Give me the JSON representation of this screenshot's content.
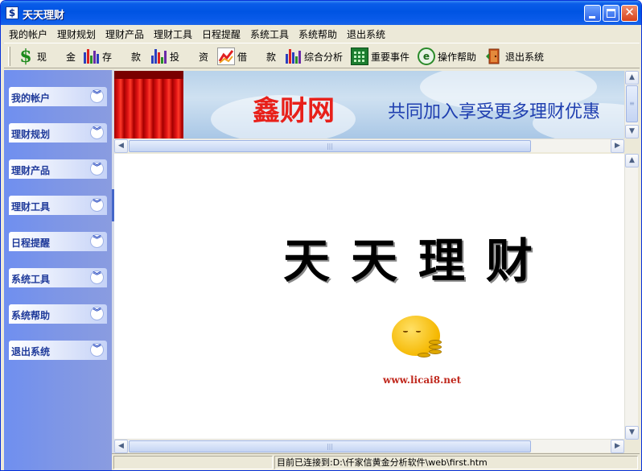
{
  "window": {
    "title": "天天理财",
    "app_icon_glyph": "$",
    "close_glyph": "✕"
  },
  "menu": [
    {
      "label": "我的帐户"
    },
    {
      "label": "理财规划"
    },
    {
      "label": "理财产品"
    },
    {
      "label": "理财工具"
    },
    {
      "label": "日程提醒"
    },
    {
      "label": "系统工具"
    },
    {
      "label": "系统帮助"
    },
    {
      "label": "退出系统"
    }
  ],
  "toolbar": [
    {
      "label": "现　　金",
      "icon": "dollar-icon"
    },
    {
      "label": "存　　款",
      "icon": "bar-chart-icon"
    },
    {
      "label": "投　　资",
      "icon": "bar-chart-icon"
    },
    {
      "label": "借　　款",
      "icon": "trend-icon"
    },
    {
      "label": "综合分析",
      "icon": "bar-chart-icon"
    },
    {
      "label": "重要事件",
      "icon": "calendar-icon"
    },
    {
      "label": "操作帮助",
      "icon": "help-icon"
    },
    {
      "label": "退出系统",
      "icon": "exit-door-icon"
    }
  ],
  "toolbar_icons": {
    "dollar_glyph": "$",
    "help_glyph": "e"
  },
  "sidebar": [
    {
      "label": "我的帐户"
    },
    {
      "label": "理财规划"
    },
    {
      "label": "理财产品"
    },
    {
      "label": "理财工具"
    },
    {
      "label": "日程提醒"
    },
    {
      "label": "系统工具"
    },
    {
      "label": "系统帮助"
    },
    {
      "label": "退出系统"
    }
  ],
  "sidebar_chevron_glyph": "︾",
  "banner": {
    "title": "鑫财网",
    "slogan": "共同加入享受更多理财优惠"
  },
  "scroll_glyphs": {
    "up": "▲",
    "down": "▼",
    "left": "◀",
    "right": "▶",
    "grip_v": "≡",
    "grip_h": "|||"
  },
  "content": {
    "title": "天天理财",
    "url": "www.licai8.net"
  },
  "status": {
    "text": "目前已连接到:D:\\仟家信黄金分析软件\\web\\first.htm"
  },
  "colors": {
    "titlebar": "#0054e3",
    "banner_title": "#e8201a",
    "banner_slogan": "#1f3fb0",
    "sidebar": "#7e96e6",
    "url": "#c0281d"
  }
}
